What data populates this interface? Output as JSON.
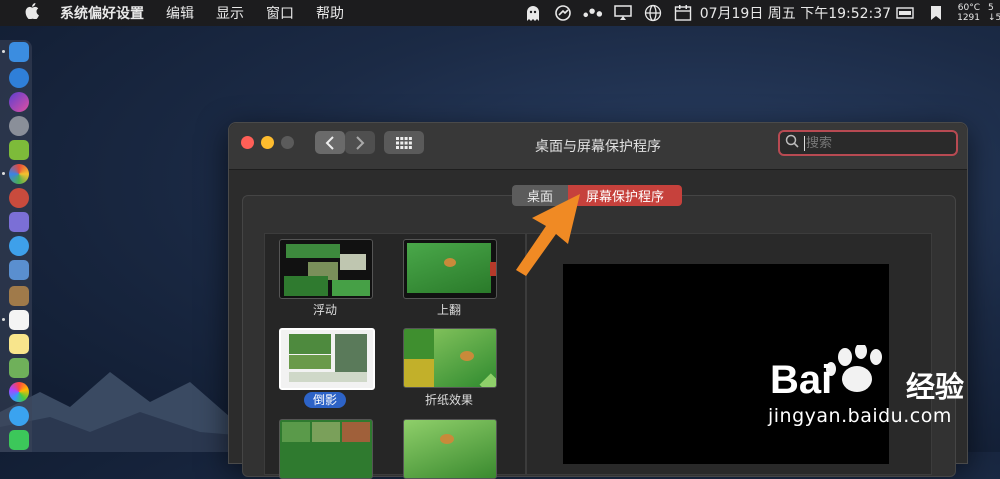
{
  "menubar": {
    "apple_icon": "apple-logo-icon",
    "items": [
      "系统偏好设置",
      "编辑",
      "显示",
      "窗口",
      "帮助"
    ],
    "clock": "07月19日 周五 下午19:52:37",
    "temp_top": "60°C",
    "temp_bottom": "1291",
    "net_top": "5",
    "net_bottom": "↓5"
  },
  "window": {
    "title": "桌面与屏幕保护程序",
    "search_placeholder": "搜索",
    "segments": [
      "桌面",
      "屏幕保护程序"
    ],
    "active_segment": "屏幕保护程序"
  },
  "screensavers": [
    {
      "label": "浮动",
      "selected": false
    },
    {
      "label": "上翻",
      "selected": false
    },
    {
      "label": "倒影",
      "selected": true
    },
    {
      "label": "折纸效果",
      "selected": false
    },
    {
      "label": "",
      "selected": false
    },
    {
      "label": "",
      "selected": false
    }
  ],
  "watermark": {
    "brand": "Bai",
    "brand_cn": "经验",
    "url": "jingyan.baidu.com"
  },
  "colors": {
    "accent_red": "#c6413c",
    "selection_blue": "#2d63c7",
    "arrow_orange": "#f08a24"
  }
}
